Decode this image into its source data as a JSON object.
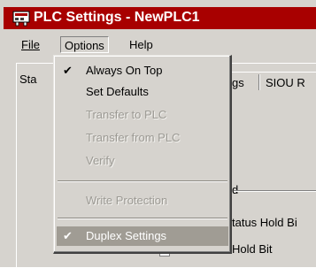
{
  "window": {
    "title": "PLC Settings - NewPLC1"
  },
  "menubar": {
    "file": "File",
    "options": "Options",
    "help": "Help"
  },
  "background": {
    "tab_left": "Sta",
    "tab_middle": "gs",
    "tab_right": "SIOU R",
    "group_label": "d",
    "option1": "tatus Hold Bi",
    "option2": "Hold Bit"
  },
  "options_menu": {
    "items": [
      {
        "label": "Always On Top",
        "checked": true,
        "enabled": true
      },
      {
        "label": "Set Defaults",
        "checked": false,
        "enabled": true
      },
      {
        "label": "Transfer to PLC",
        "checked": false,
        "enabled": false
      },
      {
        "label": "Transfer from PLC",
        "checked": false,
        "enabled": false
      },
      {
        "label": "Verify",
        "checked": false,
        "enabled": false
      },
      {
        "label": "Write Protection",
        "checked": false,
        "enabled": false
      },
      {
        "label": "Duplex Settings",
        "checked": true,
        "enabled": true,
        "highlighted": true
      }
    ]
  },
  "colors": {
    "titlebar": "#a80000",
    "menu_face": "#d6d3ce",
    "highlight": "#a09c94"
  }
}
